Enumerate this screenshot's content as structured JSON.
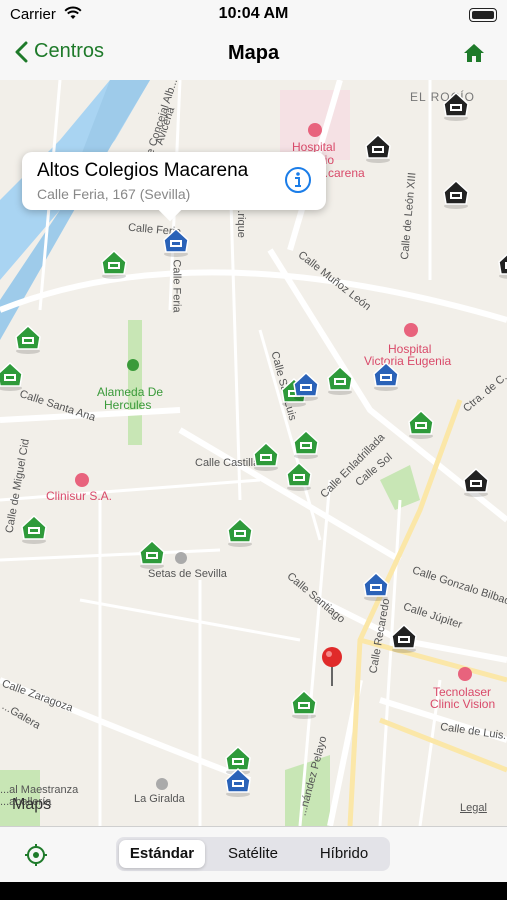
{
  "status_bar": {
    "carrier": "Carrier",
    "time": "10:04 AM"
  },
  "nav": {
    "back_label": "Centros",
    "title": "Mapa",
    "home_icon": "home-icon"
  },
  "callout": {
    "title": "Altos Colegios Macarena",
    "subtitle": "Calle Feria, 167 (Sevilla)"
  },
  "map_labels": {
    "el_rocio": "EL ROCÍO",
    "hospital1_a": "Hospital",
    "hospital1_b": "...ario",
    "hospital1_c": "...carena",
    "calle_feria_top": "Calle Feria",
    "calle_feria_v": "Calle Feria",
    "calle_munoz": "Calle Muñoz León",
    "hospital2_a": "Hospital",
    "hospital2_b": "Victoria Eugenia",
    "alameda_a": "Alameda De",
    "alameda_b": "Hercules",
    "calle_santa_ana": "Calle Santa Ana",
    "calle_san_luis": "Calle San Luis",
    "calle_castilla": "Calle Castilla",
    "calle_enladrillada": "Calle Enladrillada",
    "calle_sol": "Calle Sol",
    "ctra": "Ctra. de C...",
    "clinisur": "Clinisur S.A.",
    "calle_miguel_cid": "Calle de Miguel Cid",
    "setas": "Setas de Sevilla",
    "calle_santiago": "Calle Santiago",
    "calle_gonzalo": "Calle Gonzalo Bilbao",
    "calle_jupiter": "Calle Júpiter",
    "calle_recaredo": "Calle Recaredo",
    "tecnolaser_a": "Tecnolaser",
    "tecnolaser_b": "Clinic Vision",
    "calle_zaragoza": "Calle Zaragoza",
    "calle_luis": "Calle de Luis...",
    "la_giralda": "La Giralda",
    "calle_pelayo": "...nández Pelayo",
    "real_maestranza": "...al Maestranza",
    "caballeria": "...aballería",
    "calle_concejal": "Calle Concejal Alb...",
    "avicena": "Avicena",
    "calle_leon": "Calle de León XIII",
    "galera": "...Galera",
    "calle_enrique": "...rique"
  },
  "legal": "Legal",
  "maps_logo": "Maps",
  "segments": [
    "Estándar",
    "Satélite",
    "Híbrido"
  ],
  "selected_segment": "Estándar",
  "colors": {
    "accent_green": "#1e7a2a",
    "pin_green": "#2e9a3a",
    "pin_blue": "#2a62b8",
    "pin_black": "#222222"
  }
}
